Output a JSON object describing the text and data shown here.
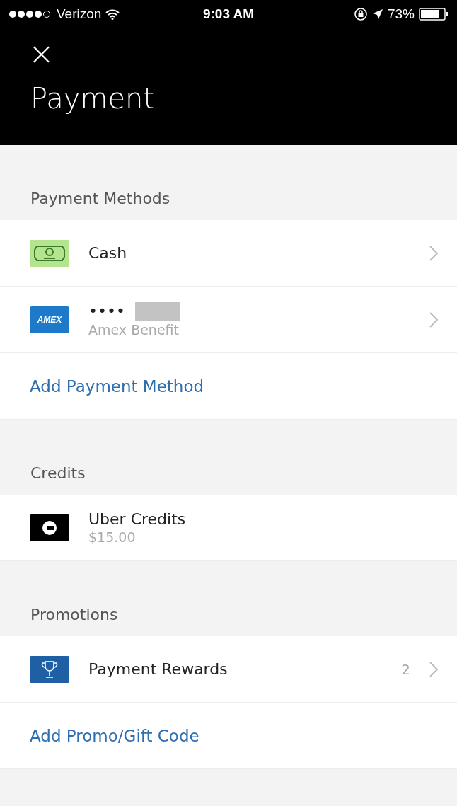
{
  "status_bar": {
    "carrier": "Verizon",
    "time": "9:03 AM",
    "battery": "73%"
  },
  "header": {
    "close": "×",
    "title": "Payment"
  },
  "sections": [
    {
      "title": "Payment Methods",
      "items": [
        {
          "kind": "cash",
          "label": "Cash",
          "chevron": true
        },
        {
          "kind": "card",
          "logo_text": "AMEX",
          "label": "••••",
          "redacted": true,
          "sublabel": "Amex Benefit",
          "chevron": true
        },
        {
          "kind": "link",
          "label": "Add Payment Method"
        }
      ]
    },
    {
      "title": "Credits",
      "items": [
        {
          "kind": "credit",
          "label": "Uber Credits",
          "sublabel": "$15.00",
          "chevron": false
        }
      ]
    },
    {
      "title": "Promotions",
      "items": [
        {
          "kind": "reward",
          "label": "Payment Rewards",
          "count": "2",
          "chevron": true
        },
        {
          "kind": "link",
          "label": "Add Promo/Gift Code"
        }
      ]
    }
  ]
}
